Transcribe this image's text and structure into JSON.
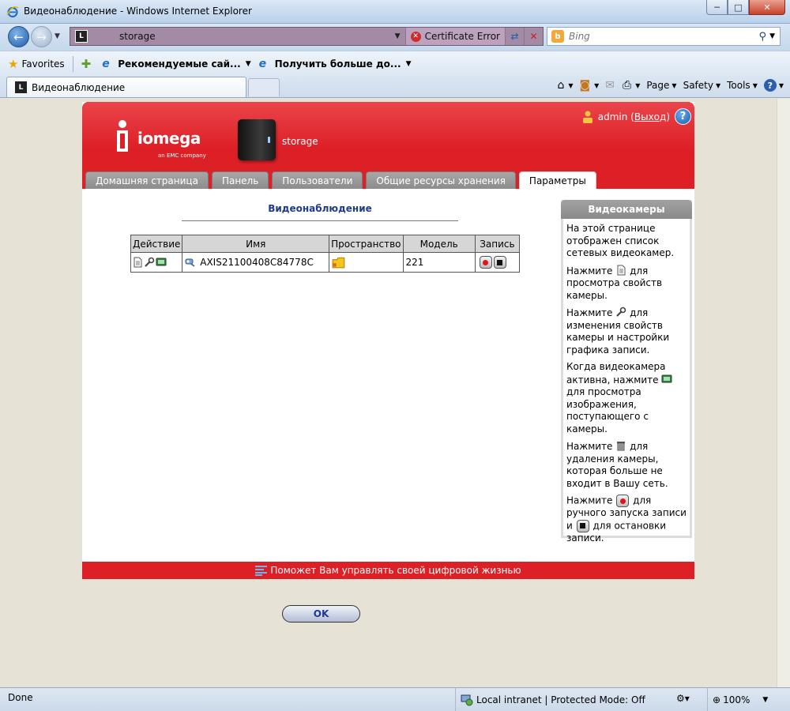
{
  "window": {
    "title": "Видеонаблюдение - Windows Internet Explorer",
    "minimize": "─",
    "maximize": "□",
    "close": "✕"
  },
  "navbar": {
    "address": "storage",
    "certificate_error": "Certificate Error",
    "search_placeholder": "Bing"
  },
  "favorites_bar": {
    "favorites_label": "Favorites",
    "items": [
      "Рекомендуемые сай...",
      "Получить больше до..."
    ]
  },
  "tabs": {
    "active_tab_title": "Видеонаблюдение"
  },
  "command_bar": {
    "page": "Page",
    "safety": "Safety",
    "tools": "Tools"
  },
  "header": {
    "brand": "iomega",
    "brand_sub": "an EMC company",
    "device_name": "storage",
    "user": "admin",
    "logout": "Выход",
    "help": "?"
  },
  "nav_tabs": [
    {
      "label": "Домашняя страница",
      "active": false
    },
    {
      "label": "Панель",
      "active": false
    },
    {
      "label": "Пользователи",
      "active": false
    },
    {
      "label": "Общие ресурсы хранения",
      "active": false
    },
    {
      "label": "Параметры",
      "active": true
    }
  ],
  "main": {
    "section_title": "Видеонаблюдение",
    "table": {
      "headers": [
        "Действие",
        "Имя",
        "Пространство",
        "Модель",
        "Запись"
      ],
      "rows": [
        {
          "name": "AXIS21100408C84778C",
          "model": "221"
        }
      ]
    },
    "ok_label": "OK"
  },
  "sidebar": {
    "title": "Видеокамеры",
    "p1": "На этой странице отображен список сетевых видеокамер.",
    "p2_before": "Нажмите",
    "p2_after": "для просмотра свойств камеры.",
    "p3_before": "Нажмите",
    "p3_after": "для изменения свойств камеры и настройки графика записи.",
    "p4_before": "Когда видеокамера активна, нажмите",
    "p4_after": "для просмотра изображения, поступающего с камеры.",
    "p5_before": "Нажмите",
    "p5_after": "для удаления камеры, которая больше не входит в Вашу сеть.",
    "p6_before": "Нажмите",
    "p6_mid": "для ручного запуска записи и",
    "p6_after": "для остановки записи."
  },
  "footer": {
    "text": "Поможет Вам управлять своей цифровой жизнью"
  },
  "statusbar": {
    "status": "Done",
    "zone": "Local intranet | Protected Mode: Off",
    "zoom": "100%"
  },
  "colors": {
    "brand_red": "#dd1f26",
    "tab_gray": "#999999",
    "title_blue": "#1f3b8f"
  }
}
